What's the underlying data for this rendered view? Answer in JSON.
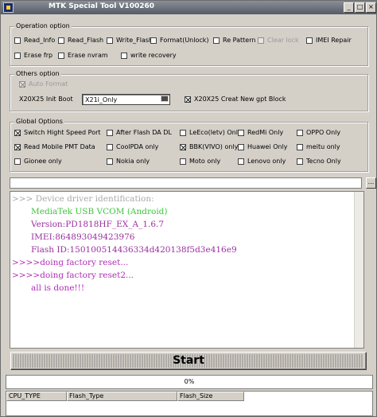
{
  "window": {
    "title": "MTK Special Tool V100260"
  },
  "operation_option": {
    "title": "Operation option",
    "items": [
      {
        "label": "Read_Info",
        "checked": false,
        "disabled": false
      },
      {
        "label": "Read_Flash",
        "checked": false,
        "disabled": false
      },
      {
        "label": "Write_Flash",
        "checked": false,
        "disabled": false
      },
      {
        "label": "Format(Unlock)",
        "checked": false,
        "disabled": false
      },
      {
        "label": "Re Pattern lo",
        "checked": false,
        "disabled": false
      },
      {
        "label": "Clear lock",
        "checked": false,
        "disabled": true
      },
      {
        "label": "IMEI Repair",
        "checked": false,
        "disabled": false
      },
      {
        "label": "Erase frp",
        "checked": false,
        "disabled": false
      },
      {
        "label": "Erase nvram",
        "checked": false,
        "disabled": false
      },
      {
        "label": "write recovery",
        "checked": false,
        "disabled": false
      }
    ]
  },
  "others_option": {
    "title": "Others option",
    "auto_format": "Auto Format",
    "init_boot_label": "X20X25 Init Boot",
    "init_boot_value": "X21i_Only",
    "gpt_block": "X20X25 Creat New gpt Block"
  },
  "global_options": {
    "title": "Global Options",
    "items": [
      {
        "label": "Switch Hight Speed Port",
        "checked": true
      },
      {
        "label": "After Flash DA DL",
        "checked": false
      },
      {
        "label": "LeEco(letv) Only",
        "checked": false
      },
      {
        "label": "RedMi Only",
        "checked": false
      },
      {
        "label": "OPPO Only",
        "checked": false
      },
      {
        "label": "Read Mobile PMT Data",
        "checked": true
      },
      {
        "label": "CoolPDA only",
        "checked": false
      },
      {
        "label": "BBK(VIVO) only",
        "checked": true
      },
      {
        "label": "Huawei Only",
        "checked": false
      },
      {
        "label": "meitu only",
        "checked": false
      },
      {
        "label": "Gionee only",
        "checked": false
      },
      {
        "label": "Nokia only",
        "checked": false
      },
      {
        "label": "Moto only",
        "checked": false
      },
      {
        "label": "Lenovo only",
        "checked": false
      },
      {
        "label": "Tecno Only",
        "checked": false
      }
    ]
  },
  "path": {
    "value": "",
    "browse_label": "..."
  },
  "log": {
    "lines": [
      {
        "text": ">>> Device driver identification:",
        "color": "#a9a9a9"
      },
      {
        "text": "MediaTek USB VCOM (Android)",
        "color": "#3ec43e"
      },
      {
        "text": "Version:PD1818HF_EX_A_1.6.7",
        "color": "#9a2fa0"
      },
      {
        "text": "IMEI:864893049423976",
        "color": "#9a2fa0"
      },
      {
        "text": "Flash ID:150100514436334d420138f5d3e416e9",
        "color": "#9a2fa0"
      },
      {
        "text": ">>>>doing factory reset...",
        "color": "#b02fb6"
      },
      {
        "text": ">>>>doing factory reset2...",
        "color": "#b02fb6"
      },
      {
        "text": "all is done!!!",
        "color": "#b02fb6"
      }
    ]
  },
  "start_button": {
    "label": "Start"
  },
  "progress": {
    "text": "0%",
    "value": 0
  },
  "list": {
    "columns": [
      "CPU_TYPE",
      "Flash_Type",
      "Flash_Size"
    ]
  },
  "colors": {
    "title_bar": "#555b66",
    "face": "#d4d0c8",
    "progress": "#3168d5"
  }
}
